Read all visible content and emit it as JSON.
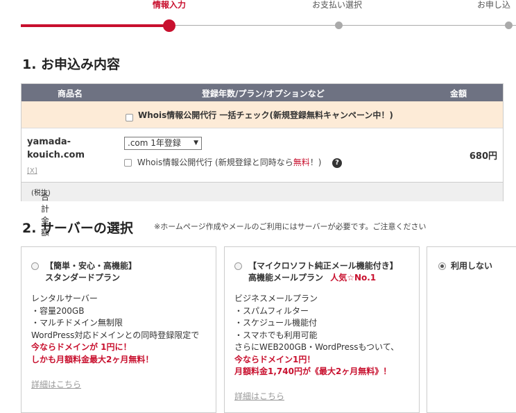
{
  "progress": {
    "steps": [
      "情報入力",
      "お支払い選択",
      "お申し込"
    ]
  },
  "section1": {
    "title": "1. お申込み内容",
    "table": {
      "headers": [
        "商品名",
        "登録年数/プラン/オプションなど",
        "金額"
      ],
      "whois_bulk": "Whois情報公開代行 一括チェック(新規登録無料キャンペーン中！)",
      "item": {
        "domain_line1": "yamada-",
        "domain_line2": "kouich.com",
        "remove": "[X]",
        "plan_select": ".com 1年登録",
        "whois_option_prefix": "Whois情報公開代行 (新規登録と同時なら",
        "whois_option_free": "無料",
        "whois_option_suffix": "！)",
        "help": "?",
        "price": "680円"
      },
      "total_label": "合計金額",
      "total_tax": "(税抜)"
    }
  },
  "section2": {
    "title": "2. サーバーの選択",
    "note": "※ホームページ作成やメールのご利用にはサーバーが必要です。ご注意ください",
    "plans": [
      {
        "title1": "【簡単・安心・高機能】",
        "title2": "スタンダードプラン",
        "lines": [
          "レンタルサーバー",
          "・容量200GB",
          "・マルチドメイン無制限",
          "WordPress対応ドメインとの同時登録限定で"
        ],
        "red_lines": [
          "今ならドメインが 1円に！",
          "しかも月額料金最大2ヶ月無料！"
        ],
        "link": "詳細はこちら"
      },
      {
        "title1": "【マイクロソフト純正メール機能付き】",
        "title2": "高機能メールプラン",
        "badge": "人気☆No.1",
        "lines": [
          "ビジネスメールプラン",
          "・スパムフィルター",
          "・スケジュール機能付",
          "・スマホでも利用可能",
          "さらにWEB200GB・WordPressもついて、"
        ],
        "red_lines": [
          "今ならドメイン1円！",
          "月額料金1,740円が《最大2ヶ月無料》！"
        ],
        "link": "詳細はこちら"
      },
      {
        "title1": "利用しない",
        "selected": true
      }
    ]
  },
  "colors": {
    "accent": "#c8102e",
    "table_header": "#6e7282",
    "campaign_row": "#fdebd7"
  }
}
